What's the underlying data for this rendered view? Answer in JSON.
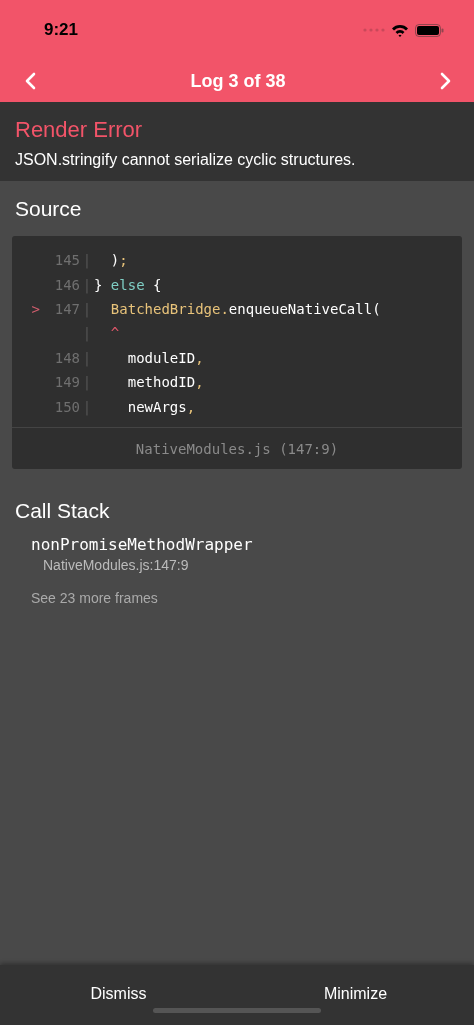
{
  "status_bar": {
    "time": "9:21"
  },
  "header": {
    "title": "Log 3 of 38"
  },
  "error": {
    "title": "Render Error",
    "message": "JSON.stringify cannot serialize cyclic structures."
  },
  "source": {
    "heading": "Source",
    "lines": [
      {
        "number": "145",
        "gutter": "|",
        "tokens": [
          {
            "kind": "plain",
            "text": "  )"
          },
          {
            "kind": "punct",
            "text": ";"
          }
        ]
      },
      {
        "number": "146",
        "gutter": "|",
        "tokens": [
          {
            "kind": "plain",
            "text": "} "
          },
          {
            "kind": "keyword",
            "text": "else"
          },
          {
            "kind": "plain",
            "text": " {"
          }
        ]
      },
      {
        "marker": ">",
        "number": "147",
        "gutter": "|",
        "tokens": [
          {
            "kind": "object",
            "text": "  BatchedBridge."
          },
          {
            "kind": "plain",
            "text": "enqueueNativeCall("
          }
        ]
      },
      {
        "gutter": "|",
        "tokens": [
          {
            "kind": "caret",
            "text": "  ^"
          }
        ]
      },
      {
        "number": "148",
        "gutter": "|",
        "tokens": [
          {
            "kind": "plain",
            "text": "    moduleID"
          },
          {
            "kind": "punct",
            "text": ","
          }
        ]
      },
      {
        "number": "149",
        "gutter": "|",
        "tokens": [
          {
            "kind": "plain",
            "text": "    methodID"
          },
          {
            "kind": "punct",
            "text": ","
          }
        ]
      },
      {
        "number": "150",
        "gutter": "|",
        "tokens": [
          {
            "kind": "plain",
            "text": "    newArgs"
          },
          {
            "kind": "punct",
            "text": ","
          }
        ]
      }
    ],
    "file": "NativeModules.js (147:9)"
  },
  "call_stack": {
    "heading": "Call Stack",
    "frames": [
      {
        "method": "nonPromiseMethodWrapper",
        "location": "NativeModules.js:147:9"
      }
    ],
    "more": "See 23 more frames"
  },
  "buttons": [
    "Dismiss",
    "Minimize"
  ]
}
